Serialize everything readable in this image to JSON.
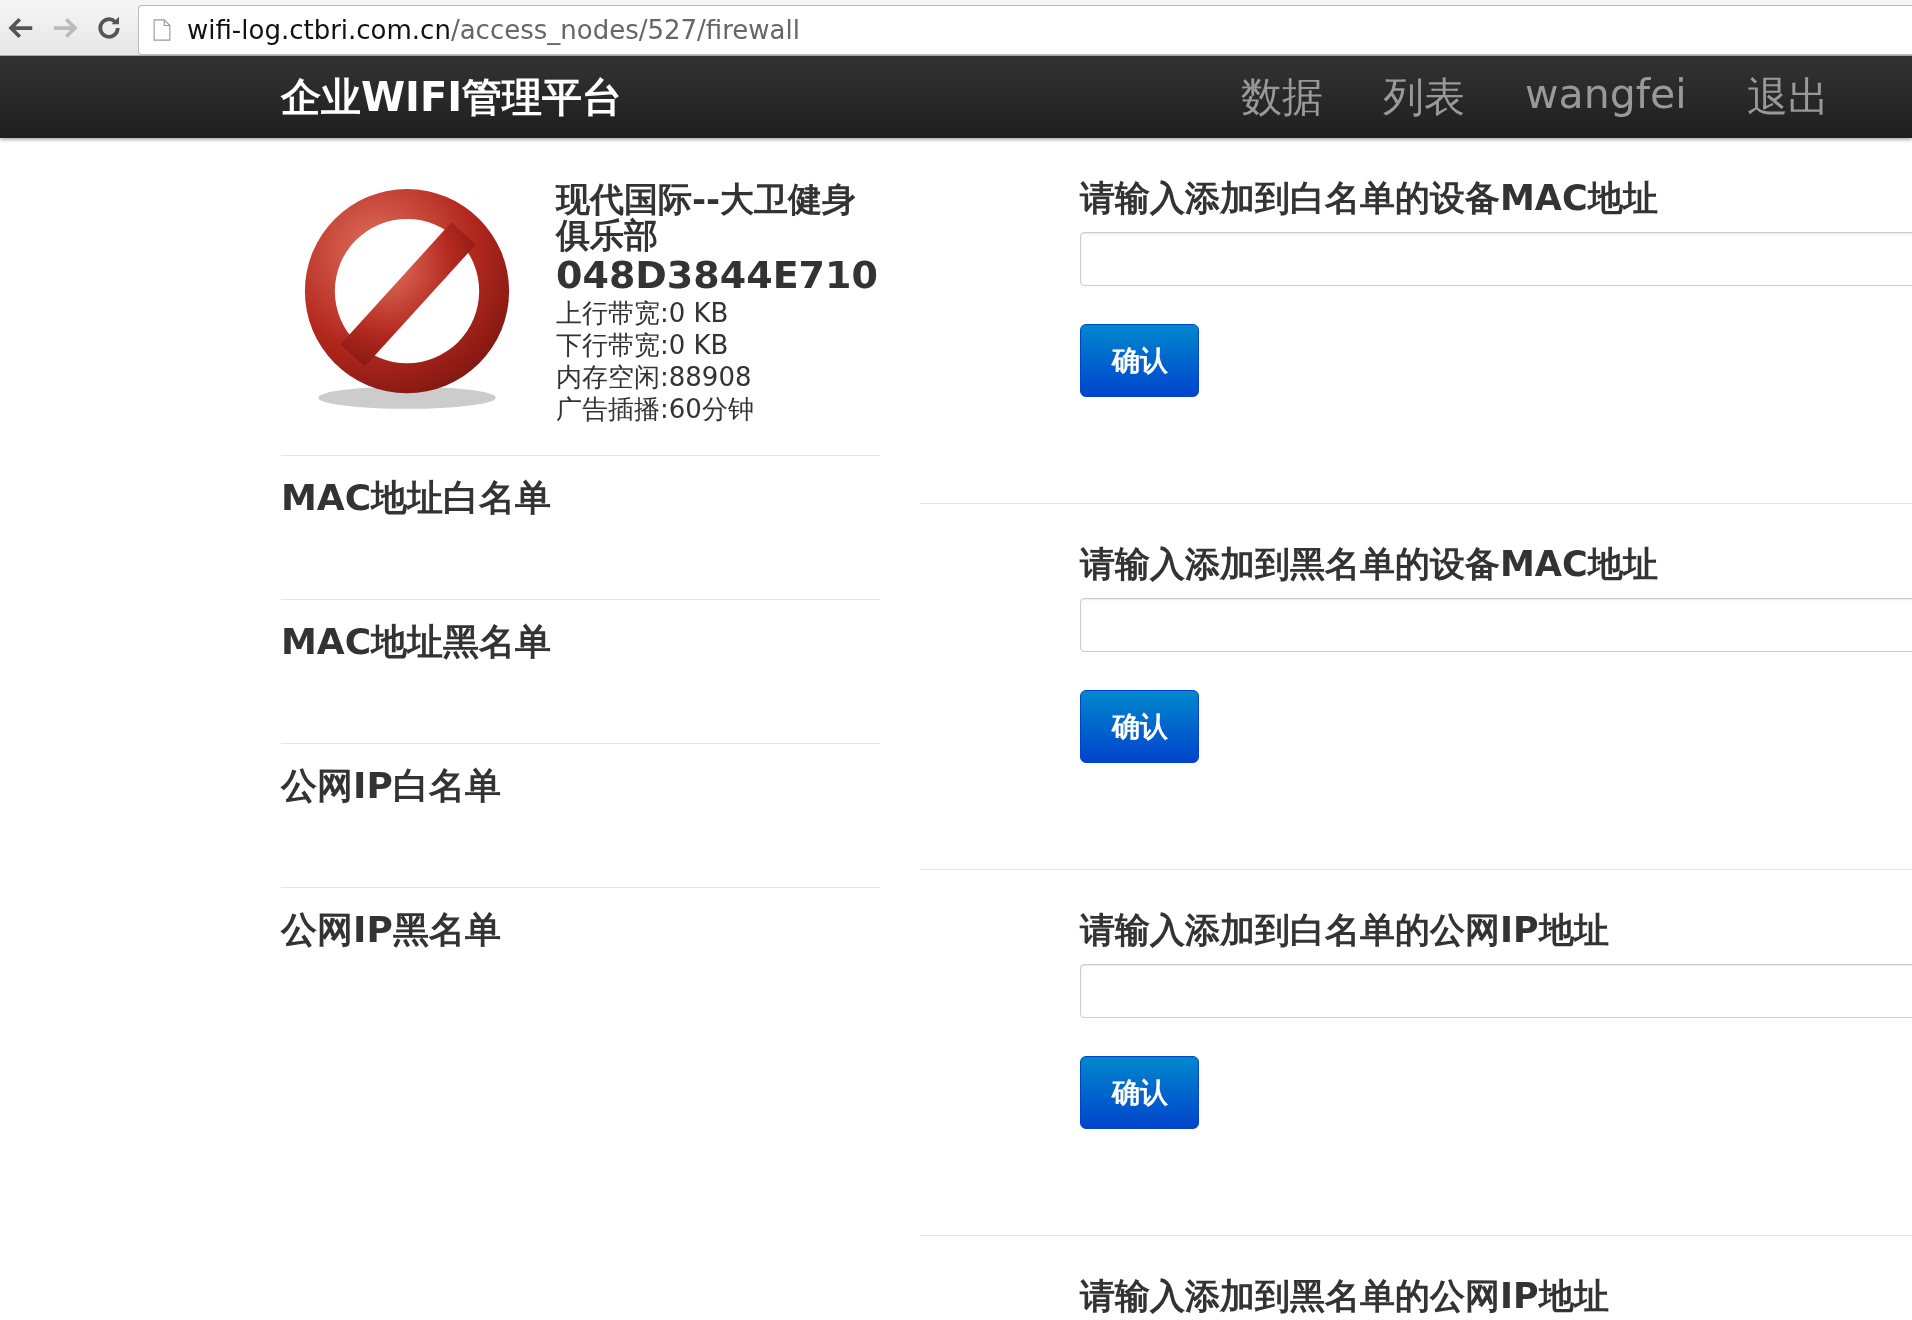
{
  "browser": {
    "url_host": "wifi-log.ctbri.com.cn",
    "url_path": "/access_nodes/527/firewall"
  },
  "navbar": {
    "brand": "企业WIFI管理平台",
    "links": [
      "数据",
      "列表",
      "wangfei",
      "退出"
    ]
  },
  "node": {
    "name": "现代国际--大卫健身俱乐部",
    "id": "048D3844E710",
    "stats": [
      "上行带宽:0 KB",
      "下行带宽:0 KB",
      "内存空闲:88908",
      "广告插播:60分钟"
    ]
  },
  "sidebar": {
    "items": [
      "MAC地址白名单",
      "MAC地址黑名单",
      "公网IP白名单",
      "公网IP黑名单"
    ]
  },
  "forms": [
    {
      "label": "请输入添加到白名单的设备MAC地址",
      "button": "确认"
    },
    {
      "label": "请输入添加到黑名单的设备MAC地址",
      "button": "确认"
    },
    {
      "label": "请输入添加到白名单的公网IP地址",
      "button": "确认"
    },
    {
      "label": "请输入添加到黑名单的公网IP地址"
    }
  ]
}
